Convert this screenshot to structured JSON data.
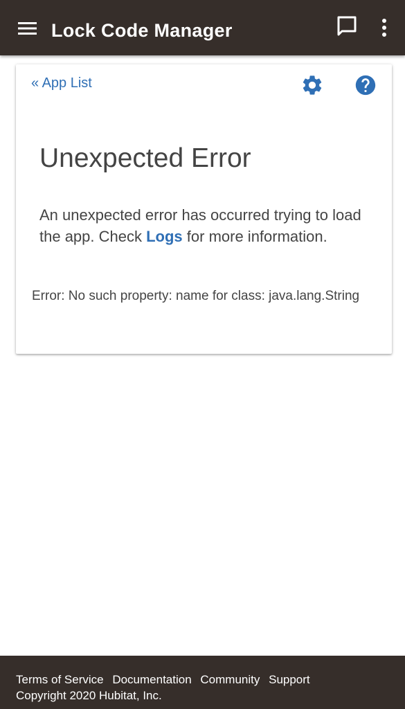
{
  "header": {
    "title": "Lock Code Manager",
    "icons": {
      "menu": "menu-icon",
      "chat": "chat-icon",
      "more": "more-vertical-icon"
    },
    "background_color": "#362e2a"
  },
  "card": {
    "back_link": "« App List",
    "settings_icon": "gear-icon",
    "help_icon": "help-icon",
    "accent_color": "#2f6fb5",
    "error_title": "Unexpected Error",
    "message_before": "An unexpected error has occurred trying to load the app. Check ",
    "message_link": "Logs",
    "message_after": " for more information.",
    "error_detail": "Error: No such property: name for class: java.lang.String"
  },
  "footer": {
    "links": [
      "Terms of Service",
      "Documentation",
      "Community",
      "Support"
    ],
    "copyright": "Copyright 2020 Hubitat, Inc."
  }
}
